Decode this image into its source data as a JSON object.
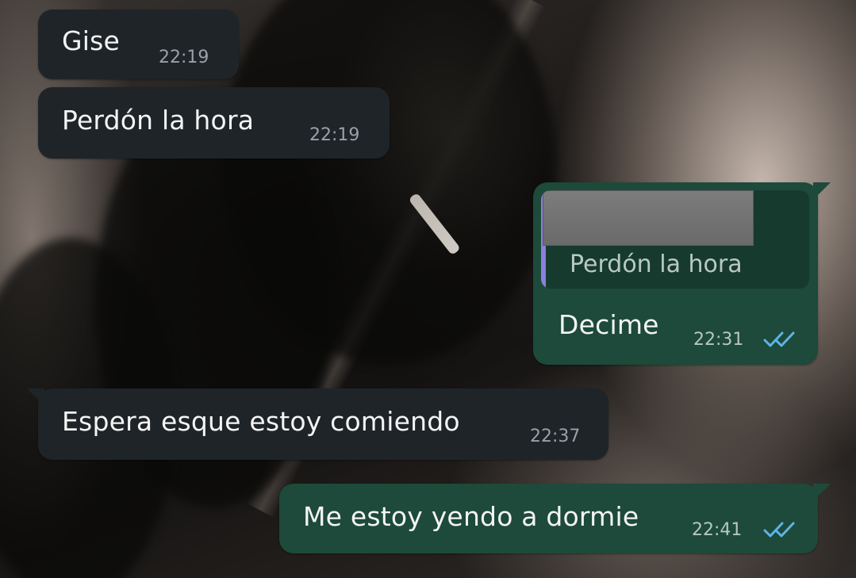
{
  "messages": [
    {
      "direction": "incoming",
      "text": "Gise",
      "time": "22:19"
    },
    {
      "direction": "incoming",
      "text": "Perdón la hora",
      "time": "22:19"
    },
    {
      "direction": "outgoing",
      "quoted_text": "Perdón la hora",
      "text": "Decime",
      "time": "22:31",
      "status_icon": "double-check-read-icon"
    },
    {
      "direction": "incoming",
      "text": "Espera esque estoy comiendo",
      "time": "22:37"
    },
    {
      "direction": "outgoing",
      "text": "Me estoy yendo a dormie",
      "time": "22:41",
      "status_icon": "double-check-read-icon"
    }
  ],
  "colors": {
    "incoming_bubble": "#1f2428",
    "outgoing_bubble": "#1d4a3a",
    "quote_bar": "#8b7fe0",
    "read_ticks": "#5fb3e8"
  }
}
